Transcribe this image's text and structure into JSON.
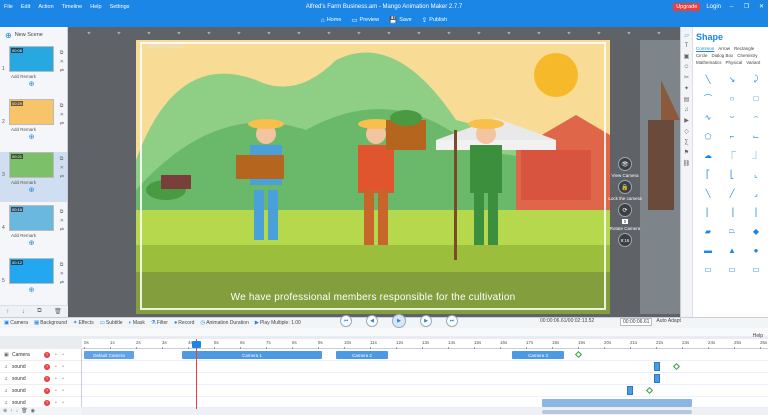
{
  "menu": [
    "File",
    "Edit",
    "Action",
    "Timeline",
    "Help",
    "Settings"
  ],
  "window_title": "Alfred's Farm Business.am - Mango Animation Maker 2.7.7",
  "account": {
    "upgrade": "Upgrade",
    "login": "Login"
  },
  "toolbar": {
    "home": "Home",
    "preview": "Preview",
    "save": "Save",
    "publish": "Publish"
  },
  "scenes": {
    "new_scene": "New Scene",
    "items": [
      {
        "num": "1",
        "time": "00:06",
        "remark": "Add Remark",
        "thumb_color": "#27a8e0"
      },
      {
        "num": "2",
        "time": "00:29",
        "remark": "Add Remark",
        "thumb_color": "#f7c46a"
      },
      {
        "num": "3",
        "time": "00:21",
        "remark": "Add Remark",
        "thumb_color": "#7cc16a"
      },
      {
        "num": "4",
        "time": "00:16",
        "remark": "Add Remark",
        "thumb_color": "#6ab7e0"
      },
      {
        "num": "5",
        "time": "00:12",
        "remark": "",
        "thumb_color": "#22a7f0"
      }
    ]
  },
  "canvas": {
    "default_camera_label": "Default Camera",
    "subtitle": "We have professional members responsible for the cultivation",
    "camera_controls": {
      "view_camera": "View Camera",
      "lock_camera": "Lock the camera",
      "rotate_camera": "Rotate Camera",
      "zoom_value": "0",
      "speed_value": "9:16"
    }
  },
  "shape_panel": {
    "title": "Shape",
    "tabs": [
      "Common",
      "Arrow",
      "Rectangle",
      "Circle",
      "Dialog Box",
      "Chemistry",
      "Mathematics",
      "Physical",
      "Variant"
    ],
    "active_tab": "Common"
  },
  "timeline": {
    "toolbar": [
      "Camera",
      "Background",
      "Effects",
      "Subtitle",
      "Mask",
      "Filter",
      "Record",
      "Animation Duration",
      "Play Multiple: 1.00"
    ],
    "time": "00:00:06.61/00:02:13.52",
    "zoom_label": "Auto Adapt",
    "zoom_input": "00:00:06.61",
    "help": "Help",
    "ticks": [
      "0s",
      "1s",
      "2s",
      "3s",
      "4s",
      "5s",
      "6s",
      "7s",
      "8s",
      "9s",
      "10s",
      "11s",
      "12s",
      "13s",
      "14s",
      "15s",
      "16s",
      "17s",
      "18s",
      "19s",
      "20s",
      "21s",
      "22s",
      "23s",
      "24s",
      "25s",
      "26s"
    ],
    "tracks": [
      {
        "icon": "camera-icon",
        "name": "Camera"
      },
      {
        "icon": "music-icon",
        "name": "sound"
      },
      {
        "icon": "music-icon",
        "name": "sound"
      },
      {
        "icon": "music-icon",
        "name": "sound"
      },
      {
        "icon": "music-icon",
        "name": "sound"
      }
    ],
    "clips": [
      {
        "label": "Default Camera",
        "type": "default"
      },
      {
        "label": "Camera 1",
        "type": "camera"
      },
      {
        "label": "Camera 2",
        "type": "camera"
      },
      {
        "label": "Camera 3",
        "type": "camera"
      }
    ]
  },
  "colors": {
    "brand": "#1b86e6",
    "upgrade": "#e84040",
    "playhead": "#e84040",
    "keyframe": "#2ea043"
  }
}
